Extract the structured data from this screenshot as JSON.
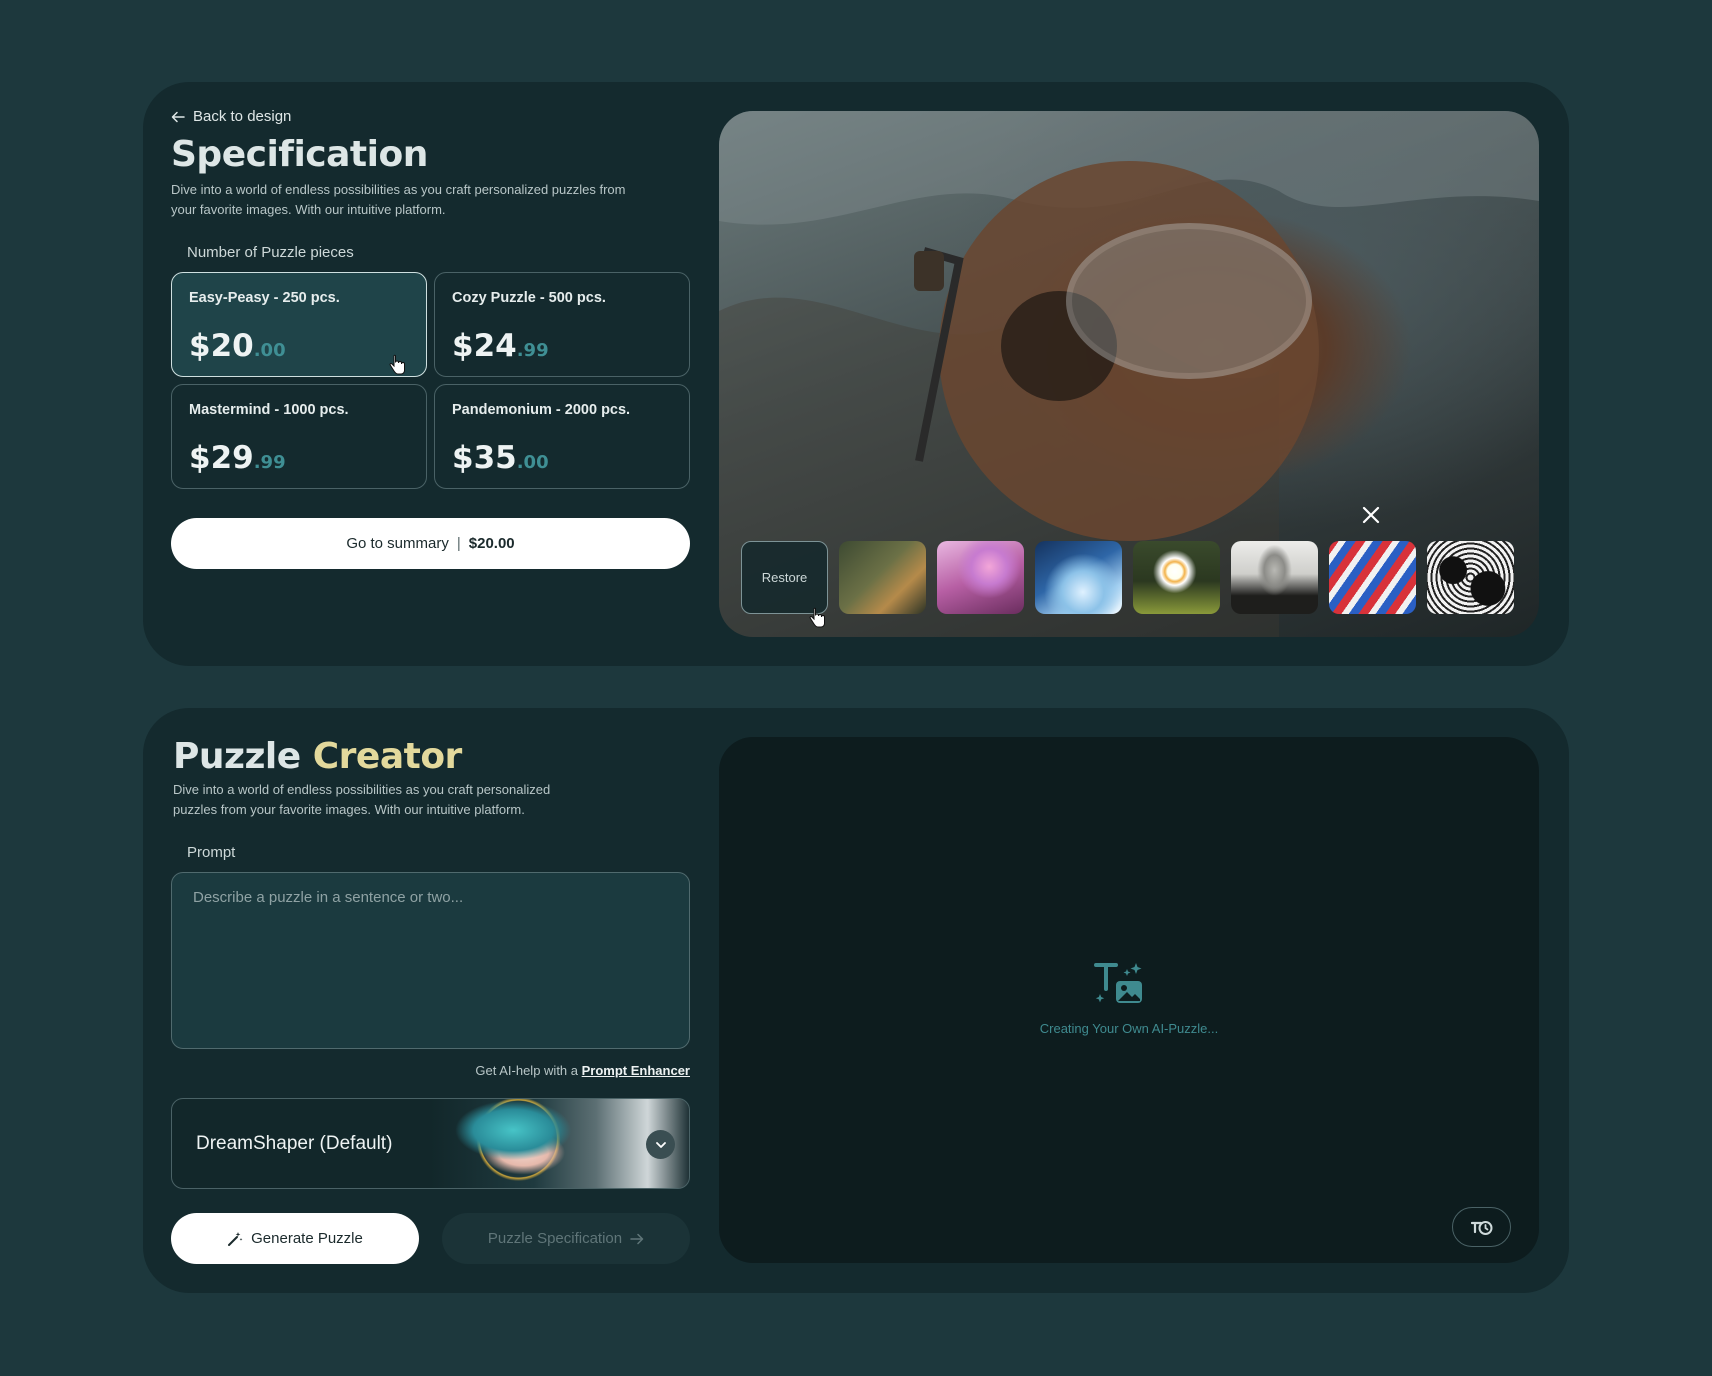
{
  "specification": {
    "back_label": "Back to design",
    "title": "Specification",
    "description": "Dive into a world of endless possibilities as you craft personalized puzzles from your favorite images. With our intuitive platform.",
    "pieces_label": "Number of Puzzle pieces",
    "options": [
      {
        "title": "Easy-Peasy - 250 pcs.",
        "price": "$20",
        "cents": ".00",
        "selected": true
      },
      {
        "title": "Cozy Puzzle - 500 pcs.",
        "price": "$24",
        "cents": ".99",
        "selected": false
      },
      {
        "title": "Mastermind - 1000 pcs.",
        "price": "$29",
        "cents": ".99",
        "selected": false
      },
      {
        "title": "Pandemonium - 2000 pcs.",
        "price": "$35",
        "cents": ".00",
        "selected": false
      }
    ],
    "summary_button": {
      "label": "Go to summary",
      "separator": "|",
      "amount": "$20.00"
    },
    "thumbnails": {
      "restore_label": "Restore"
    }
  },
  "creator": {
    "title_part1": "Puzzle",
    "title_part2": "Creator",
    "description": "Dive into a world of endless possibilities as you craft personalized puzzles from your favorite images. With our intuitive platform.",
    "prompt_label": "Prompt",
    "prompt_placeholder": "Describe a puzzle in a sentence or two...",
    "prompt_value": "",
    "enhancer_text": "Get AI-help with a",
    "enhancer_link": "Prompt Enhancer",
    "model_selected": "DreamShaper (Default)",
    "generate_label": "Generate Puzzle",
    "spec_label": "Puzzle Specification",
    "status_text": "Creating Your Own AI-Puzzle..."
  },
  "colors": {
    "background": "#1d383d",
    "card": "#142a2e",
    "accent_teal": "#3f8f94",
    "accent_yellow": "#e3d99c"
  },
  "icons": [
    "arrow-left-icon",
    "close-icon",
    "pointer-hand-icon",
    "chevron-down-icon",
    "magic-wand-icon",
    "arrow-right-icon",
    "text-to-image-icon",
    "history-icon"
  ]
}
